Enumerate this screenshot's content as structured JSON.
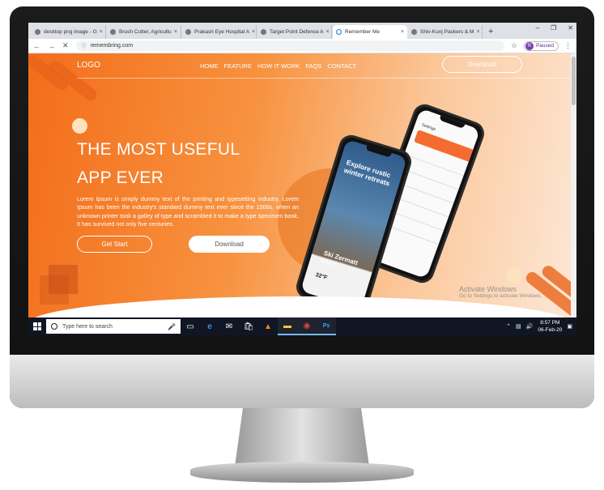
{
  "browser": {
    "tabs": [
      {
        "label": "desktop png image - G",
        "active": false
      },
      {
        "label": "Brush Cutter, Agricultu",
        "active": false
      },
      {
        "label": "Prakash Eye Hospital A",
        "active": false
      },
      {
        "label": "Target Point Defence A",
        "active": false
      },
      {
        "label": "Remember Me",
        "active": true
      },
      {
        "label": "Shiv-Kunj Packers & M",
        "active": false
      }
    ],
    "new_tab": "+",
    "url": "remembring.com",
    "profile_initial": "R",
    "profile_status": "Paused"
  },
  "site": {
    "logo": "LOGO",
    "nav": [
      "HOME",
      "FEATURE",
      "HOW IT WORK",
      "FAQS",
      "CONTACT"
    ],
    "header_button": "Download",
    "hero_line1": "THE MOST USEFUL",
    "hero_line2": "APP EVER",
    "hero_text": "Lorem Ipsum is simply dummy text of the printing and typesetting industry. Lorem Ipsum has been the industry's standard dummy text ever since the 1500s, when an unknown printer took a galley of type and scrambled it to make a type specimen book. It has survived not only five centuries.",
    "primary_button": "Get Start",
    "secondary_button": "Download",
    "phone_title": "Explore rustic winter retreats",
    "phone_place": "Ski Zermatt",
    "phone_price": "$288.00",
    "phone_temp": "32°F",
    "settings_title": "Settings"
  },
  "os": {
    "watermark_title": "Activate Windows",
    "watermark_sub": "Go to Settings to activate Windows.",
    "search_placeholder": "Type here to search",
    "time": "8:57 PM",
    "date": "06-Feb-20"
  },
  "colors": {
    "accent": "#f36d1a",
    "taskbar": "#101623"
  },
  "icons": [
    "windows-start-icon",
    "search-icon",
    "mic-icon",
    "edge-icon",
    "mail-icon",
    "store-icon",
    "vlc-icon",
    "folder-icon",
    "chrome-icon",
    "photoshop-icon",
    "chevron-up-icon",
    "network-icon",
    "volume-icon",
    "notification-icon"
  ]
}
